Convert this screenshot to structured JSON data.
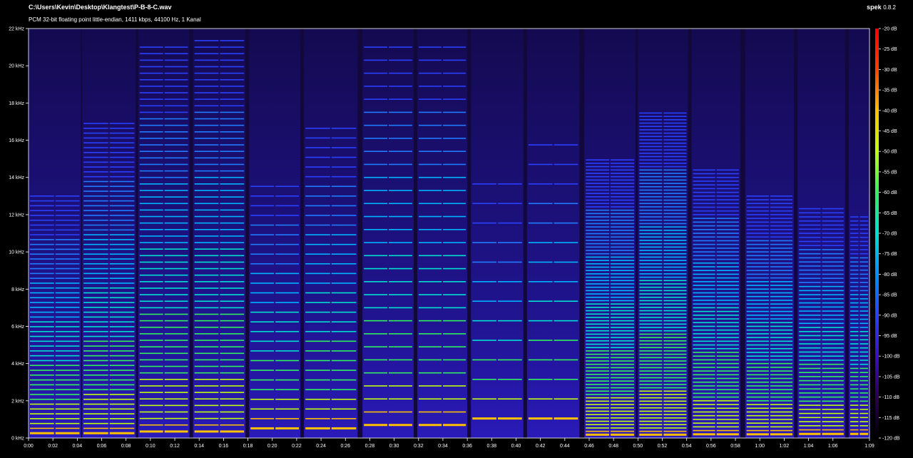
{
  "header": {
    "file_path": "C:\\Users\\Kevin\\Desktop\\Klangtest\\P-B-8-C.wav",
    "file_info": "PCM 32-bit floating point little-endian, 1411 kbps, 44100 Hz, 1 Kanal",
    "app_name": "spek",
    "app_version": "0.8.2"
  },
  "chart_data": {
    "type": "heatmap",
    "title": "",
    "xlabel": "",
    "ylabel": "",
    "x_ticks": [
      "0:00",
      "0:02",
      "0:04",
      "0:06",
      "0:08",
      "0:10",
      "0:12",
      "0:14",
      "0:16",
      "0:18",
      "0:20",
      "0:22",
      "0:24",
      "0:26",
      "0:28",
      "0:30",
      "0:32",
      "0:34",
      "0:36",
      "0:38",
      "0:40",
      "0:42",
      "0:44",
      "0:46",
      "0:48",
      "0:50",
      "0:52",
      "0:54",
      "0:56",
      "0:58",
      "1:00",
      "1:02",
      "1:04",
      "1:06",
      "1:09"
    ],
    "x_tick_seconds": [
      0,
      2,
      4,
      6,
      8,
      10,
      12,
      14,
      16,
      18,
      20,
      22,
      24,
      26,
      28,
      30,
      32,
      34,
      36,
      38,
      40,
      42,
      44,
      46,
      48,
      50,
      52,
      54,
      56,
      58,
      60,
      62,
      64,
      66,
      69
    ],
    "xlim_seconds": [
      0,
      69
    ],
    "y_ticks": [
      "0 kHz",
      "2 kHz",
      "4 kHz",
      "6 kHz",
      "8 kHz",
      "10 kHz",
      "12 kHz",
      "14 kHz",
      "16 kHz",
      "18 kHz",
      "20 kHz",
      "22 kHz"
    ],
    "y_tick_khz": [
      0,
      2,
      4,
      6,
      8,
      10,
      12,
      14,
      16,
      18,
      20,
      22
    ],
    "ylim_khz": [
      0,
      22
    ],
    "colorbar_ticks": [
      "-20 dB",
      "-25 dB",
      "-30 dB",
      "-35 dB",
      "-40 dB",
      "-45 dB",
      "-50 dB",
      "-55 dB",
      "-60 dB",
      "-65 dB",
      "-70 dB",
      "-75 dB",
      "-80 dB",
      "-85 dB",
      "-90 dB",
      "-95 dB",
      "-100 dB",
      "-105 dB",
      "-110 dB",
      "-115 dB",
      "-120 dB"
    ],
    "colorbar_db": [
      -20,
      -25,
      -30,
      -35,
      -40,
      -45,
      -50,
      -55,
      -60,
      -65,
      -70,
      -75,
      -80,
      -85,
      -90,
      -95,
      -100,
      -105,
      -110,
      -115,
      -120
    ],
    "colorbar_range_db": [
      -120,
      -20
    ],
    "colormap": [
      "#000000",
      "#2a0055",
      "#3a10c0",
      "#2a40ff",
      "#0090ff",
      "#00e0d0",
      "#30f060",
      "#c0ff10",
      "#ffc000",
      "#ff4000",
      "#ff0000"
    ],
    "notes": [
      {
        "start_s": 0.0,
        "end_s": 4.3,
        "fundamental_khz": 0.26,
        "max_harmonic_khz": 13.0
      },
      {
        "start_s": 4.4,
        "end_s": 8.8,
        "fundamental_khz": 0.26,
        "max_harmonic_khz": 17.0
      },
      {
        "start_s": 9.0,
        "end_s": 13.2,
        "fundamental_khz": 0.35,
        "max_harmonic_khz": 21.0
      },
      {
        "start_s": 13.5,
        "end_s": 17.8,
        "fundamental_khz": 0.35,
        "max_harmonic_khz": 21.5
      },
      {
        "start_s": 18.1,
        "end_s": 22.3,
        "fundamental_khz": 0.52,
        "max_harmonic_khz": 14.0
      },
      {
        "start_s": 22.6,
        "end_s": 27.0,
        "fundamental_khz": 0.52,
        "max_harmonic_khz": 17.0
      },
      {
        "start_s": 27.4,
        "end_s": 31.6,
        "fundamental_khz": 0.7,
        "max_harmonic_khz": 21.5
      },
      {
        "start_s": 31.9,
        "end_s": 36.0,
        "fundamental_khz": 0.7,
        "max_harmonic_khz": 21.5
      },
      {
        "start_s": 36.3,
        "end_s": 40.6,
        "fundamental_khz": 1.05,
        "max_harmonic_khz": 14.0
      },
      {
        "start_s": 40.9,
        "end_s": 45.2,
        "fundamental_khz": 1.05,
        "max_harmonic_khz": 16.5
      },
      {
        "start_s": 45.6,
        "end_s": 49.8,
        "fundamental_khz": 0.18,
        "max_harmonic_khz": 15.0
      },
      {
        "start_s": 50.0,
        "end_s": 54.1,
        "fundamental_khz": 0.18,
        "max_harmonic_khz": 17.5
      },
      {
        "start_s": 54.4,
        "end_s": 58.4,
        "fundamental_khz": 0.2,
        "max_harmonic_khz": 14.5
      },
      {
        "start_s": 58.8,
        "end_s": 62.8,
        "fundamental_khz": 0.2,
        "max_harmonic_khz": 13.0
      },
      {
        "start_s": 63.1,
        "end_s": 67.0,
        "fundamental_khz": 0.22,
        "max_harmonic_khz": 12.5
      },
      {
        "start_s": 67.3,
        "end_s": 69.0,
        "fundamental_khz": 0.22,
        "max_harmonic_khz": 12.0
      }
    ]
  }
}
